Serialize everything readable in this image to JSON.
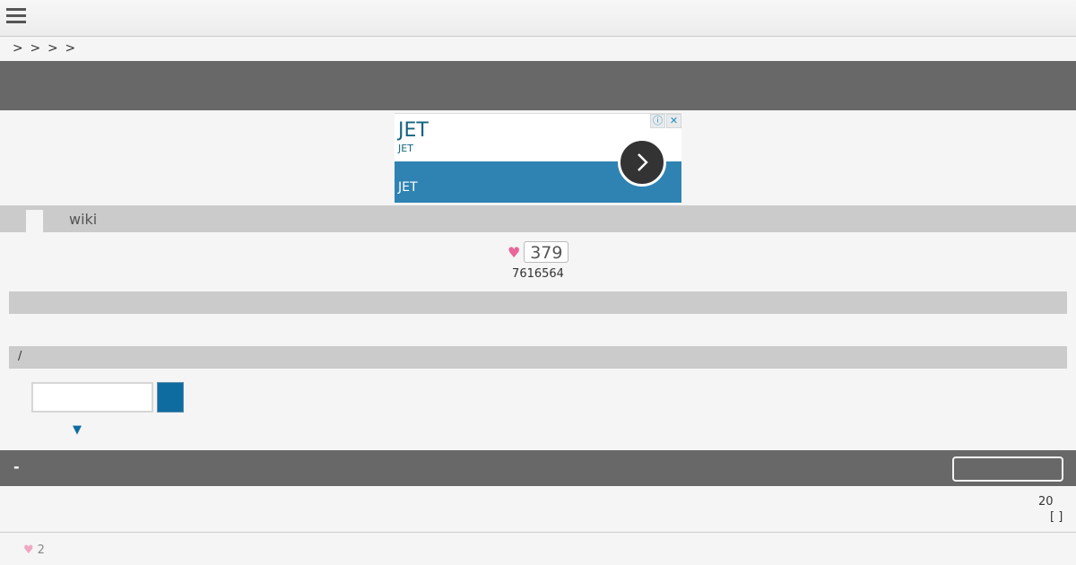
{
  "header": {
    "menu_icon": "hamburger-menu-icon"
  },
  "breadcrumb": [
    ">",
    ">",
    ">",
    ">"
  ],
  "ad": {
    "title": "JET",
    "subtitle": "JET",
    "band_text": "JET",
    "info_icon": "ⓘ",
    "close_icon": "✕"
  },
  "page": {
    "wiki_label": "wiki",
    "likes": "379",
    "view_count": "7616564",
    "section2_label": "/"
  },
  "search": {
    "input_value": "",
    "placeholder": "",
    "dropdown_arrow": "▼"
  },
  "footer_band": {
    "dash": "-"
  },
  "bottom": {
    "right_number": "20",
    "right_brackets": "[ ]",
    "like_count": "2"
  },
  "colors": {
    "accent": "#0f6ca0",
    "heart": "#e9659a",
    "dark_band": "#686868"
  }
}
